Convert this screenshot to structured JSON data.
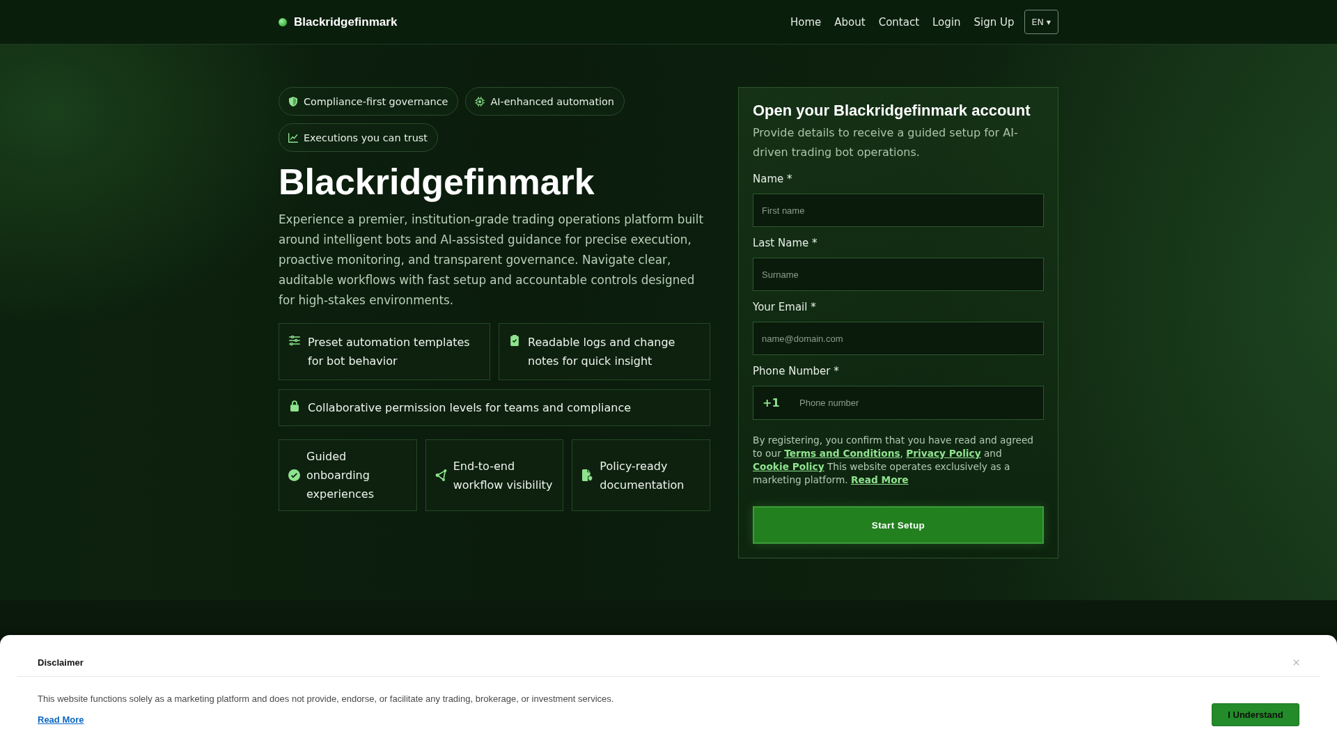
{
  "header": {
    "brand": "Blackridgefinmark",
    "nav": [
      {
        "label": "Home"
      },
      {
        "label": "About"
      },
      {
        "label": "Contact"
      },
      {
        "label": "Login"
      },
      {
        "label": "Sign Up"
      }
    ],
    "language": "EN ▾"
  },
  "hero": {
    "badges": [
      {
        "label": "Compliance-first governance"
      },
      {
        "label": "AI-enhanced automation"
      },
      {
        "label": "Executions you can trust"
      }
    ],
    "title": "Blackridgefinmark",
    "description": "Experience a premier, institution-grade trading operations platform built around intelligent bots and AI-assisted guidance for precise execution, proactive monitoring, and transparent governance. Navigate clear, auditable workflows with fast setup and accountable controls designed for high-stakes environments.",
    "features": [
      "Preset automation templates for bot behavior",
      "Readable logs and change notes for quick insight",
      "Collaborative permission levels for teams and compliance"
    ],
    "highlights": [
      "Guided onboarding experiences",
      "End-to-end workflow visibility",
      "Policy-ready documentation"
    ]
  },
  "signup_form": {
    "title": "Open your Blackridgefinmark account",
    "subtitle": "Provide details to receive a guided setup for AI-driven trading bot operations.",
    "fields": [
      {
        "label": "Name *",
        "placeholder": "First name"
      },
      {
        "label": "Last Name *",
        "placeholder": "Surname"
      },
      {
        "label": "Your Email *",
        "placeholder": "name@domain.com"
      },
      {
        "label": "Phone Number *",
        "prefix": "+1",
        "placeholder": "Phone number"
      }
    ],
    "consent": [
      {
        "kind": "text",
        "text": "By registering, you confirm that you have read and agreed to our "
      },
      {
        "kind": "link",
        "text": "Terms and Conditions"
      },
      {
        "kind": "text",
        "text": ", "
      },
      {
        "kind": "link",
        "text": "Privacy Policy"
      },
      {
        "kind": "text",
        "text": " and "
      },
      {
        "kind": "link",
        "text": "Cookie Policy"
      },
      {
        "kind": "text",
        "text": " This website operates exclusively as a marketing platform. "
      },
      {
        "kind": "link",
        "text": "Read More"
      }
    ],
    "submit": "Start Setup"
  },
  "disclaimer": {
    "title": "Disclaimer",
    "text": "This website functions solely as a marketing platform and does not provide, endorse, or facilitate any trading, brokerage, or investment services.",
    "link": "Read More",
    "button": "I Understand"
  }
}
